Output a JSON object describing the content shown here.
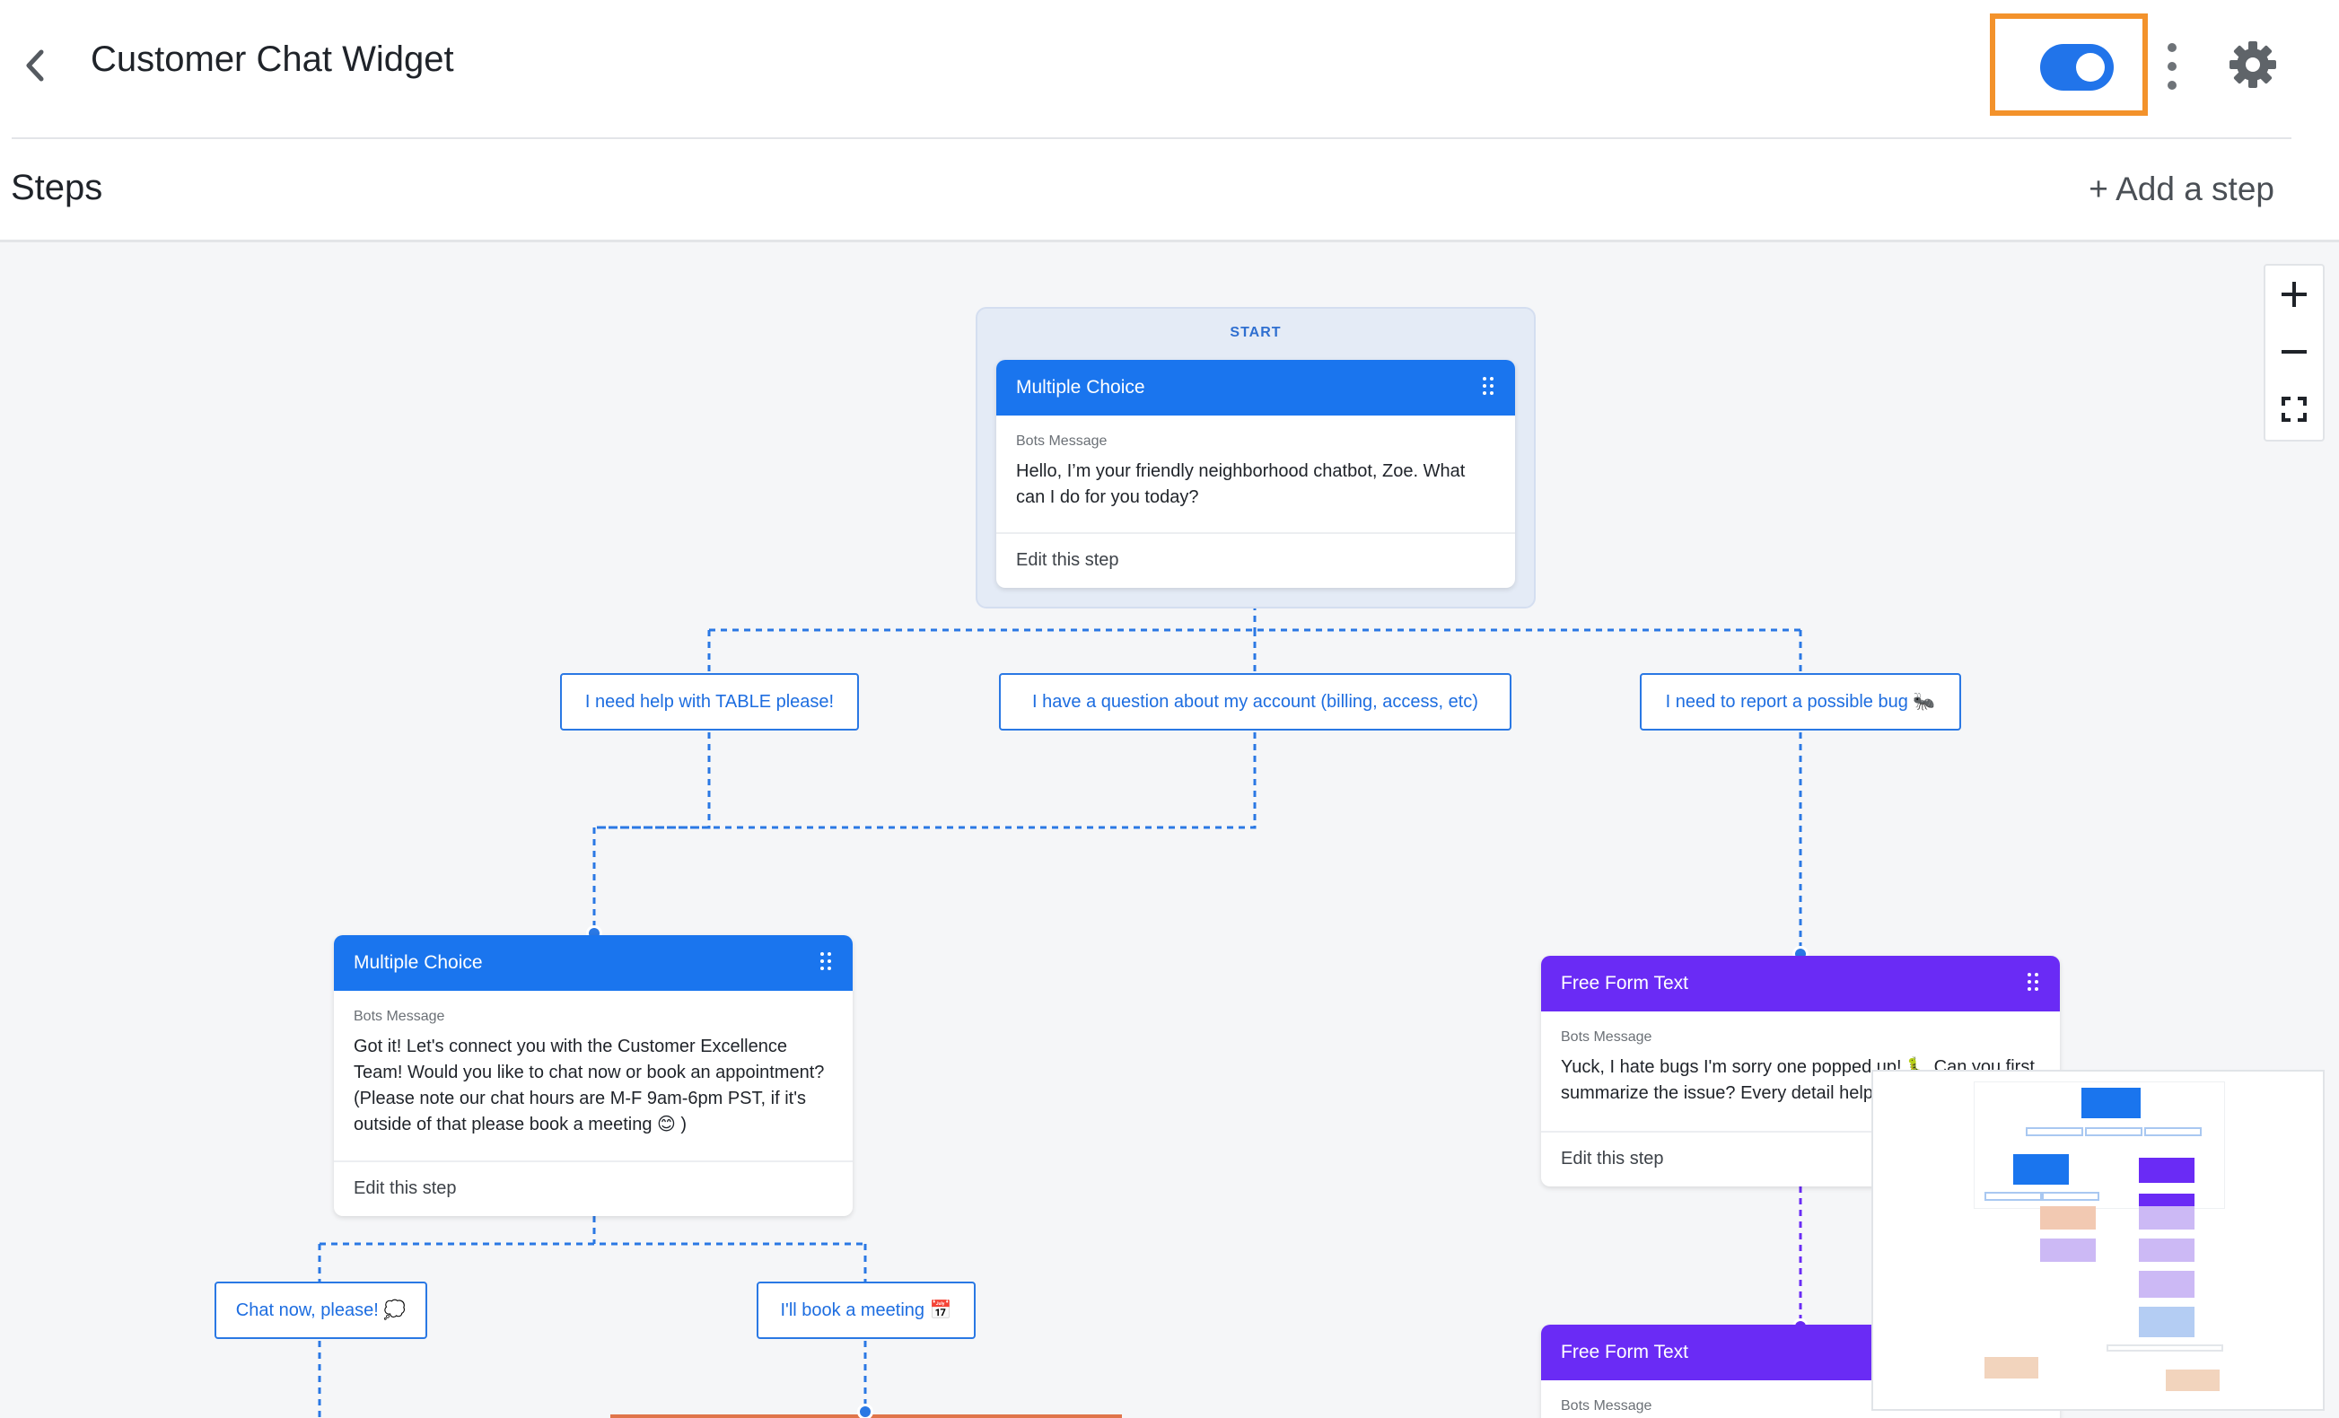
{
  "header": {
    "title": "Customer Chat Widget",
    "toggle_state": "on",
    "icons": {
      "back": "chevron-left-icon",
      "more": "kebab-menu-icon",
      "settings": "gear-icon"
    },
    "colors": {
      "accent": "#2174ea",
      "highlight": "#f3922b"
    }
  },
  "steps_bar": {
    "title": "Steps",
    "add_step_label": "+ Add a step"
  },
  "flow": {
    "start_label": "START",
    "start_card": {
      "type": "Multiple Choice",
      "label": "Bots Message",
      "message": "Hello, I’m your friendly neighborhood chatbot, Zoe. What can I do for you today?",
      "edit": "Edit this step"
    },
    "options": [
      "I need help with TABLE please!",
      "I have a question about my account (billing, access, etc)",
      "I need to report a possible bug 🐜"
    ],
    "left_card": {
      "type": "Multiple Choice",
      "label": "Bots Message",
      "message": "Got it! Let's connect you with the Customer Excellence Team! Would you like to chat now or book an appointment? (Please note our chat hours are M-F 9am-6pm PST, if it's outside of that please book a meeting 😊 )",
      "edit": "Edit this step"
    },
    "left_options": [
      "Chat now, please! 💭",
      "I'll book a meeting 📅"
    ],
    "right_card": {
      "type": "Free Form Text",
      "label": "Bots Message",
      "message": "Yuck, I hate bugs I'm sorry one popped up! 🐛 Can you first summarize the issue? Every detail helps",
      "edit": "Edit this step"
    },
    "bottom_card": {
      "type": "Free Form Text",
      "label": "Bots Message"
    },
    "colors": {
      "multiple_choice": "#1a75ee",
      "free_form": "#6a2bf5"
    }
  },
  "zoom_controls": {
    "icons": [
      "plus-icon",
      "minus-icon",
      "fit-screen-icon"
    ]
  }
}
